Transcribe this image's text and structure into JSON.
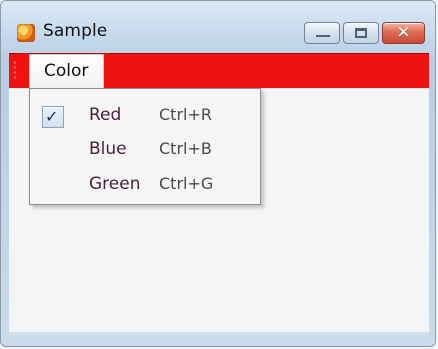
{
  "window": {
    "title": "Sample"
  },
  "menu": {
    "top_label": "Color",
    "items": [
      {
        "label": "Red",
        "shortcut": "Ctrl+R",
        "checked": true
      },
      {
        "label": "Blue",
        "shortcut": "Ctrl+B",
        "checked": false
      },
      {
        "label": "Green",
        "shortcut": "Ctrl+G",
        "checked": false
      }
    ]
  },
  "icons": {
    "app": "app-icon",
    "minimize": "minimize-icon",
    "maximize": "maximize-icon",
    "close": "close-icon",
    "check": "check-icon"
  },
  "colors": {
    "menubar": "#f01111",
    "menu_text": "#45223b",
    "close_button": "#d84f39"
  }
}
